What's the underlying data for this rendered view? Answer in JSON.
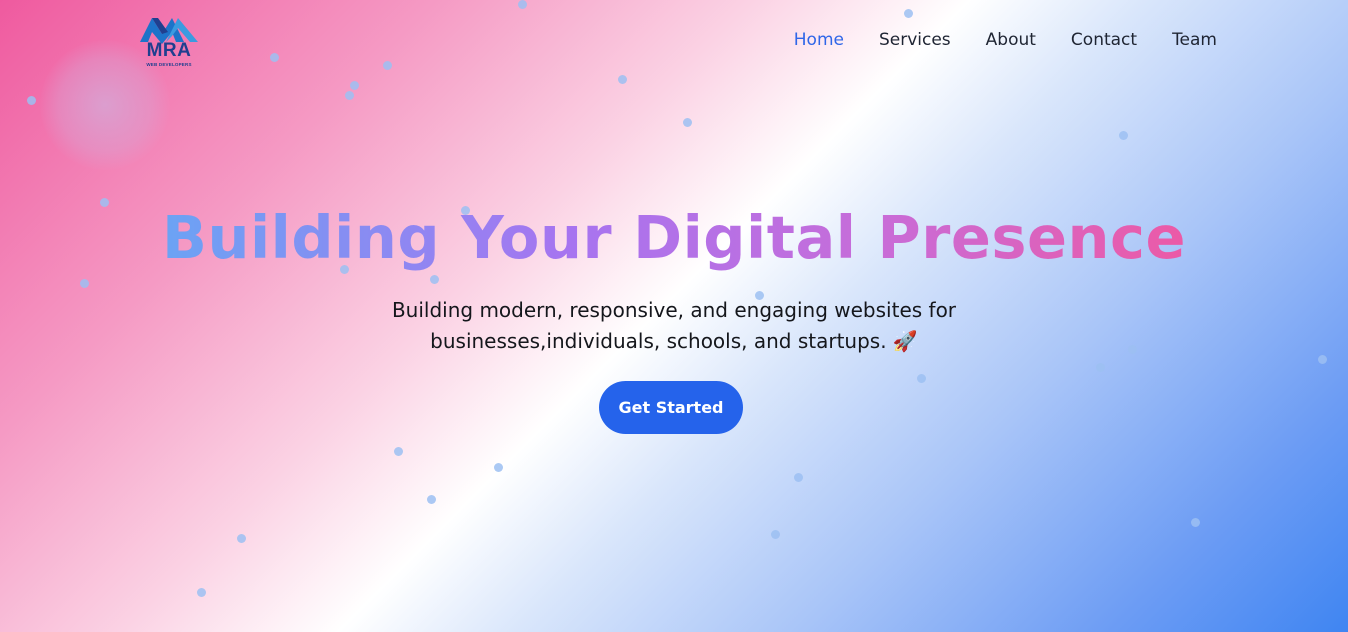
{
  "brand": {
    "name": "MRA",
    "tagline": "WEB DEVELOPERS",
    "logo_icon": "mountain-m-logo-icon",
    "color": "#1f3f8f"
  },
  "nav": {
    "items": [
      {
        "label": "Home",
        "active": true
      },
      {
        "label": "Services",
        "active": false
      },
      {
        "label": "About",
        "active": false
      },
      {
        "label": "Contact",
        "active": false
      },
      {
        "label": "Team",
        "active": false
      }
    ],
    "active_color": "#2f66e8"
  },
  "hero": {
    "title": "Building Your Digital Presence",
    "subtitle": "Building modern, responsive, and engaging websites for businesses,individuals, schools, and startups. 🚀",
    "cta_label": "Get Started",
    "cta_color": "#2563eb"
  },
  "colors": {
    "gradient_pink": "#ef5a9f",
    "gradient_blue": "#3f85f2",
    "particle": "#9cc0f2"
  }
}
